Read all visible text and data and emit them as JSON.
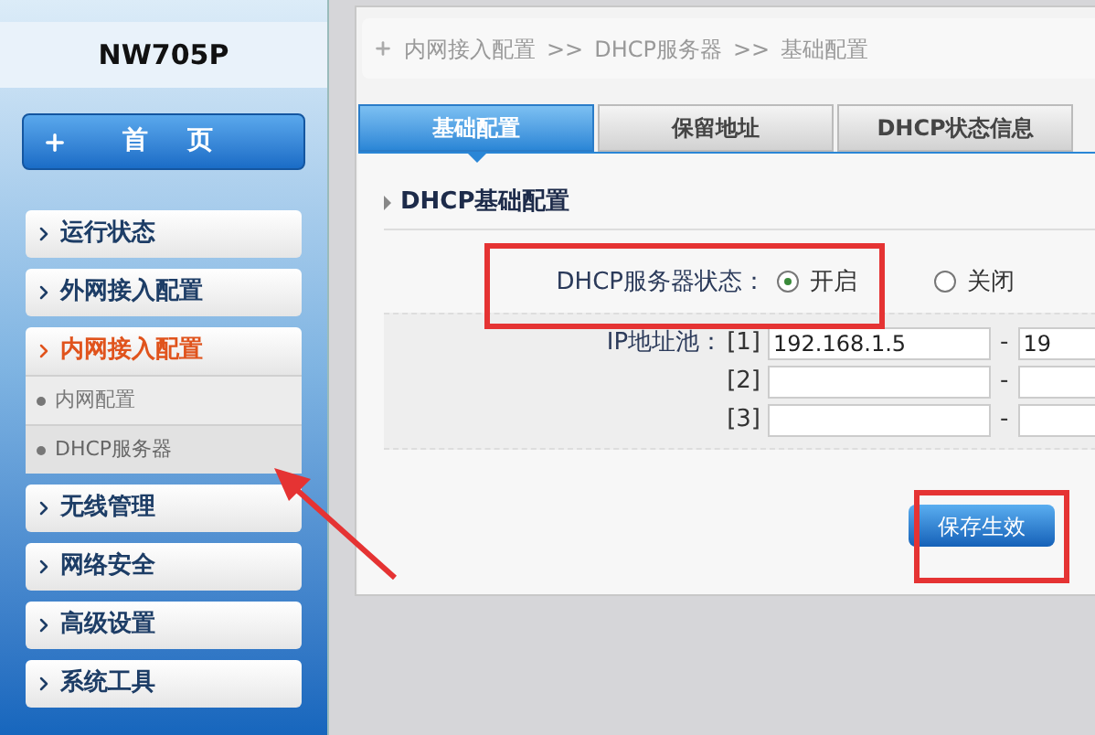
{
  "sidebar": {
    "title": "NW705P",
    "home_button": {
      "label": "首 页"
    },
    "menu": [
      {
        "label": "运行状态",
        "selected": false,
        "expanded": false
      },
      {
        "label": "外网接入配置",
        "selected": false,
        "expanded": false
      },
      {
        "label": "内网接入配置",
        "selected": true,
        "expanded": true,
        "children": [
          {
            "label": "内网配置",
            "selected": false
          },
          {
            "label": "DHCP服务器",
            "selected": true
          }
        ]
      },
      {
        "label": "无线管理",
        "selected": false,
        "expanded": false
      },
      {
        "label": "网络安全",
        "selected": false,
        "expanded": false
      },
      {
        "label": "高级设置",
        "selected": false,
        "expanded": false
      },
      {
        "label": "系统工具",
        "selected": false,
        "expanded": false
      }
    ]
  },
  "breadcrumb": {
    "separator": ">>",
    "items": [
      "内网接入配置",
      "DHCP服务器",
      "基础配置"
    ]
  },
  "tabs": [
    {
      "label": "基础配置",
      "selected": true
    },
    {
      "label": "保留地址",
      "selected": false
    },
    {
      "label": "DHCP状态信息",
      "selected": false
    }
  ],
  "section_title": "DHCP基础配置",
  "status": {
    "label": "DHCP服务器状态：",
    "options": [
      {
        "label": "开启",
        "selected": true
      },
      {
        "label": "关闭",
        "selected": false
      }
    ]
  },
  "pool": {
    "label": "IP地址池：",
    "separator": "-",
    "rows": [
      {
        "index": "[1]",
        "start": "192.168.1.5",
        "end": "19"
      },
      {
        "index": "[2]"
      },
      {
        "index": "[3]"
      }
    ]
  },
  "save_button": "保存生效",
  "annotations": [
    {
      "kind": "box"
    },
    {
      "kind": "box"
    },
    {
      "kind": "arrow"
    }
  ]
}
